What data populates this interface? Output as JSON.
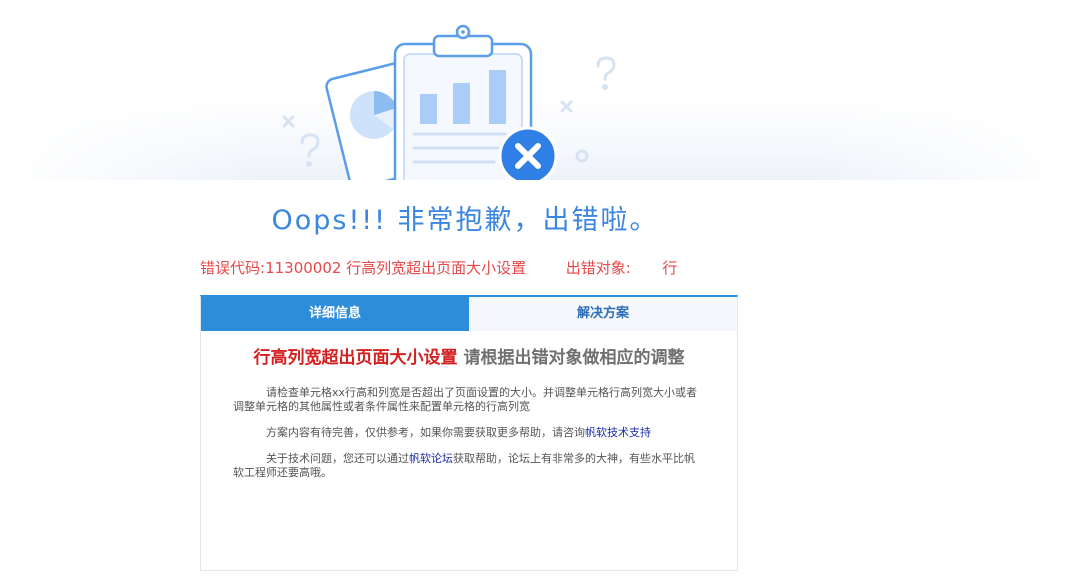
{
  "title": "Oops!!! 非常抱歉，出错啦。",
  "error": {
    "code_label": "错误代码:",
    "code_value": "11300002 行高列宽超出页面大小设置",
    "object_label": "出错对象:",
    "object_value": "行"
  },
  "tabs": [
    {
      "label": "详细信息"
    },
    {
      "label": "解决方案"
    }
  ],
  "detail": {
    "headline_red": "行高列宽超出页面大小设置",
    "headline_grey": "请根据出错对象做相应的调整",
    "para1": "请检查单元格xx行高和列宽是否超出了页面设置的大小。并调整单元格行高列宽大小或者调整单元格的其他属性或者条件属性来配置单元格的行高列宽",
    "para2_before": "方案内容有待完善，仅供参考，如果你需要获取更多帮助，请咨询",
    "para2_link": "帆软技术支持",
    "para3_before": "关于技术问题，您还可以通过",
    "para3_link": "帆软论坛",
    "para3_after": "获取帮助，论坛上有非常多的大神，有些水平比帆软工程师还要高哦。"
  },
  "colors": {
    "accent": "#2e8ddb",
    "title": "#3b86e0",
    "error": "#e84848",
    "headline_red": "#d42020",
    "close_badge": "#2f7fe6"
  },
  "icons": [
    "clipboard-chart-icon",
    "pie-chart-card-icon",
    "close-badge-icon",
    "question-mark-icon"
  ]
}
